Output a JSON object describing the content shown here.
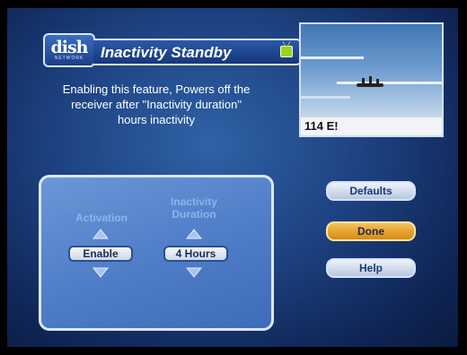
{
  "header": {
    "logo_text": "dish",
    "logo_subtext": "NETWORK",
    "title": "Inactivity Standby"
  },
  "description": {
    "line1": "Enabling this feature, Powers off the",
    "line2": "receiver after \"Inactivity duration\"",
    "line3": "hours inactivity"
  },
  "preview": {
    "channel": "114 E!"
  },
  "settings": {
    "activation": {
      "label": "Activation",
      "value": "Enable"
    },
    "duration": {
      "label_line1": "Inactivity",
      "label_line2": "Duration",
      "value": "4 Hours"
    }
  },
  "buttons": {
    "defaults": "Defaults",
    "done": "Done",
    "help": "Help"
  },
  "colors": {
    "background": "#1d4180",
    "done_button": "#e8a52a",
    "panel": "#5683cb"
  }
}
